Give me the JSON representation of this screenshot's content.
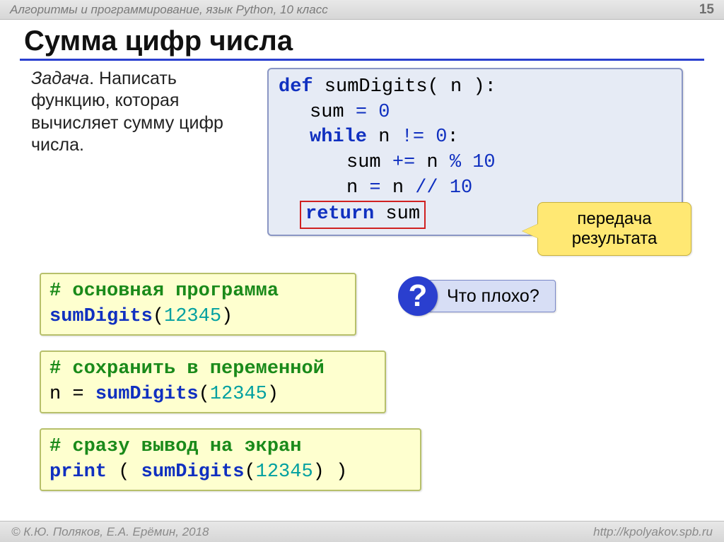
{
  "header": {
    "course": "Алгоритмы и программирование, язык Python, 10 класс",
    "page": "15"
  },
  "title": "Сумма цифр числа",
  "task": {
    "label": "Задача",
    "text": ". Написать функцию, которая вычисляет сумму цифр числа."
  },
  "code1": {
    "l1a": "def",
    "l1b": " sumDigits( n ):",
    "l2a": "sum",
    "l2b": "=",
    "l2c": "0",
    "l3a": "while",
    "l3b": " n",
    "l3c": "!=",
    "l3d": "0",
    "l3e": ":",
    "l4a": "sum",
    "l4b": "+=",
    "l4c": "n",
    "l4d": "%",
    "l4e": "10",
    "l5a": "n",
    "l5b": "=",
    "l5c": "n",
    "l5d": "//",
    "l5e": "10",
    "l6a": "return",
    "l6b": " sum"
  },
  "callout": "передача результата",
  "yb1": {
    "c": "# основная программа",
    "f": "sumDigits",
    "p1": "(",
    "n": "12345",
    "p2": ")"
  },
  "yb2": {
    "c": "# сохранить в переменной",
    "pre": "n = ",
    "f": "sumDigits",
    "p1": "(",
    "n": "12345",
    "p2": ")"
  },
  "yb3": {
    "c": "# сразу вывод на экран",
    "pr": "print",
    "sp": " ( ",
    "f": "sumDigits",
    "p1": "(",
    "n": "12345",
    "p2": ") )"
  },
  "question": {
    "mark": "?",
    "text": "Что плохо?"
  },
  "footer": {
    "left": "© К.Ю. Поляков, Е.А. Ерёмин, 2018",
    "right": "http://kpolyakov.spb.ru"
  }
}
